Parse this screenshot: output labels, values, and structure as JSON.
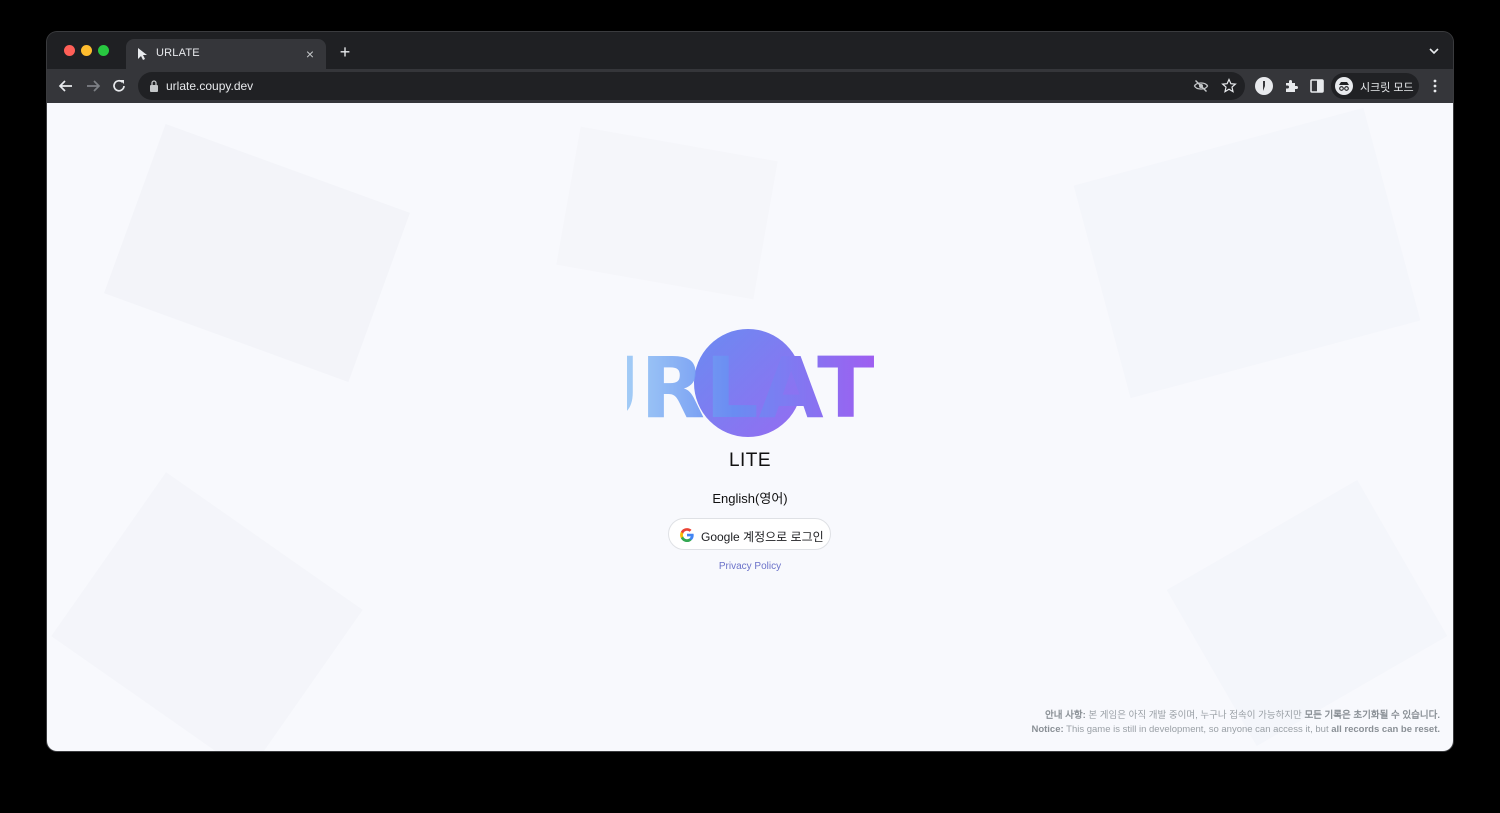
{
  "tab": {
    "title": "URLATE",
    "close": "×",
    "new_tab": "+"
  },
  "address_bar": {
    "url": "urlate.coupy.dev"
  },
  "profile": {
    "label": "시크릿 모드"
  },
  "page": {
    "logo_text": "URLATE",
    "subtitle": "LITE",
    "language": "English(영어)",
    "login_button": "Google 계정으로 로그인",
    "privacy_link": "Privacy Policy",
    "notice_ko_label": "안내 사항:",
    "notice_ko_text": " 본 게임은 아직 개발 중이며, 누구나 접속이 가능하지만 ",
    "notice_ko_bold": "모든 기록은 초기화될 수 있습니다.",
    "notice_en_label": "Notice:",
    "notice_en_text": " This game is still in development, so anyone can access it, but ",
    "notice_en_bold": "all records can be reset."
  },
  "colors": {
    "logo_gradient": [
      "#8fd3f4",
      "#6a8cf2",
      "#a855f7"
    ],
    "privacy_link": "#6b72c9"
  },
  "icons": [
    "cursor-icon",
    "close-icon",
    "plus-icon",
    "chevron-down-icon",
    "back-arrow-icon",
    "forward-arrow-icon",
    "reload-icon",
    "lock-icon",
    "eye-off-icon",
    "star-icon",
    "extension-puzzle-icon",
    "sidepanel-icon",
    "incognito-icon",
    "more-vert-icon",
    "google-g-icon"
  ]
}
